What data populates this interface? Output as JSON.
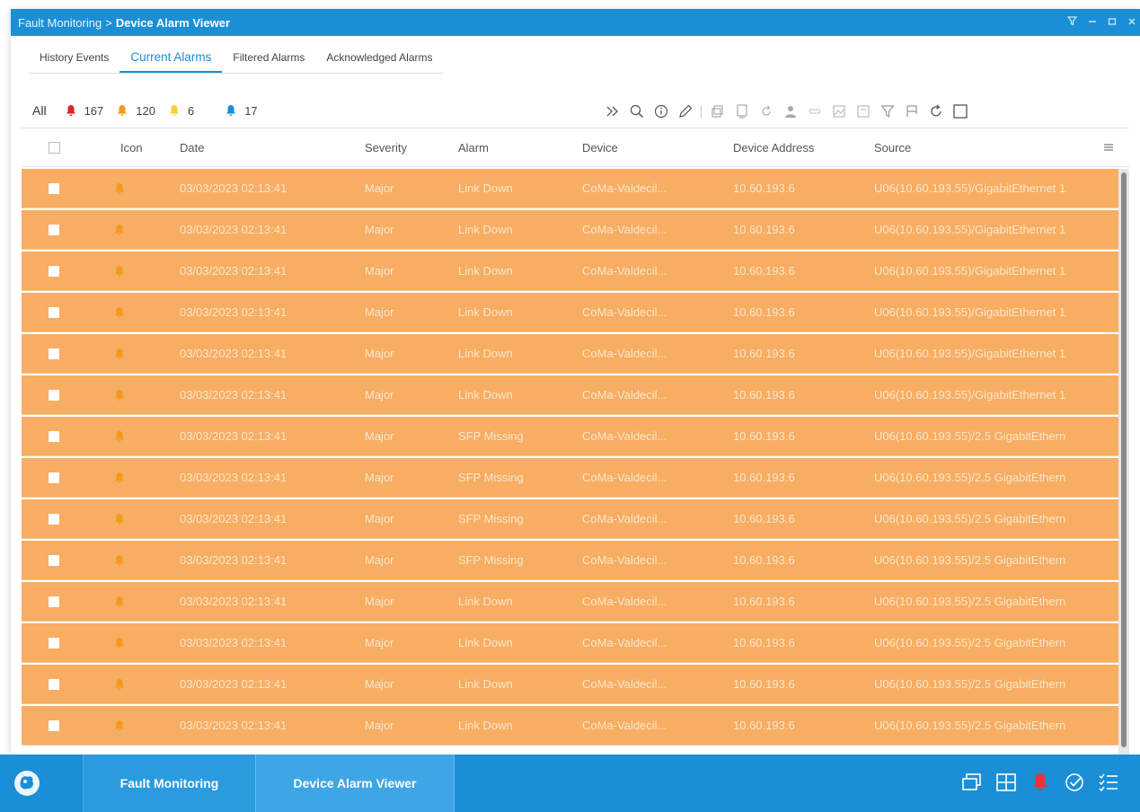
{
  "window": {
    "breadcrumb_parent": "Fault Monitoring",
    "breadcrumb_sep": ">",
    "breadcrumb_current": "Device Alarm Viewer",
    "controls": [
      "filter",
      "minimize",
      "maximize",
      "close"
    ]
  },
  "tabs": [
    {
      "label": "History Events",
      "active": false
    },
    {
      "label": "Current Alarms",
      "active": true
    },
    {
      "label": "Filtered Alarms",
      "active": false
    },
    {
      "label": "Acknowledged Alarms",
      "active": false
    }
  ],
  "summary": {
    "all_label": "All",
    "critical_count": "167",
    "major_count": "120",
    "minor_count": "6",
    "info_count": "17",
    "colors": {
      "critical": "#d9262b",
      "major": "#f39a1b",
      "minor": "#f5d23a",
      "info": "#1a8fd6"
    }
  },
  "toolbar": {
    "icons": [
      "expand-icon",
      "search-icon",
      "info-icon",
      "edit-icon",
      "copy-icon",
      "device-icon",
      "refresh-small-icon",
      "user-icon",
      "link-icon",
      "image-icon",
      "chart-icon",
      "filter-icon",
      "flag-icon",
      "reload-icon",
      "select-all-icon"
    ]
  },
  "grid": {
    "headers": {
      "icon": "Icon",
      "date": "Date",
      "severity": "Severity",
      "alarm": "Alarm",
      "device": "Device",
      "address": "Device Address",
      "source": "Source"
    },
    "rows": [
      {
        "date": "03/03/2023 02:13:41",
        "severity": "Major",
        "alarm": "Link Down",
        "device": "CoMa-Valdecil...",
        "address": "10.60.193.6",
        "source": "U06(10.60.193.55)/GigabitEthernet 1"
      },
      {
        "date": "03/03/2023 02:13:41",
        "severity": "Major",
        "alarm": "Link Down",
        "device": "CoMa-Valdecil...",
        "address": "10.60.193.6",
        "source": "U06(10.60.193.55)/GigabitEthernet 1"
      },
      {
        "date": "03/03/2023 02:13:41",
        "severity": "Major",
        "alarm": "Link Down",
        "device": "CoMa-Valdecil...",
        "address": "10.60.193.6",
        "source": "U06(10.60.193.55)/GigabitEthernet 1"
      },
      {
        "date": "03/03/2023 02:13:41",
        "severity": "Major",
        "alarm": "Link Down",
        "device": "CoMa-Valdecil...",
        "address": "10.60.193.6",
        "source": "U06(10.60.193.55)/GigabitEthernet 1"
      },
      {
        "date": "03/03/2023 02:13:41",
        "severity": "Major",
        "alarm": "Link Down",
        "device": "CoMa-Valdecil...",
        "address": "10.60.193.6",
        "source": "U06(10.60.193.55)/GigabitEthernet 1"
      },
      {
        "date": "03/03/2023 02:13:41",
        "severity": "Major",
        "alarm": "Link Down",
        "device": "CoMa-Valdecil...",
        "address": "10.60.193.6",
        "source": "U06(10.60.193.55)/GigabitEthernet 1"
      },
      {
        "date": "03/03/2023 02:13:41",
        "severity": "Major",
        "alarm": "SFP Missing",
        "device": "CoMa-Valdecil...",
        "address": "10.60.193.6",
        "source": "U06(10.60.193.55)/2.5 GigabitEthern"
      },
      {
        "date": "03/03/2023 02:13:41",
        "severity": "Major",
        "alarm": "SFP Missing",
        "device": "CoMa-Valdecil...",
        "address": "10.60.193.6",
        "source": "U06(10.60.193.55)/2.5 GigabitEthern"
      },
      {
        "date": "03/03/2023 02:13:41",
        "severity": "Major",
        "alarm": "SFP Missing",
        "device": "CoMa-Valdecil...",
        "address": "10.60.193.6",
        "source": "U06(10.60.193.55)/2.5 GigabitEthern"
      },
      {
        "date": "03/03/2023 02:13:41",
        "severity": "Major",
        "alarm": "SFP Missing",
        "device": "CoMa-Valdecil...",
        "address": "10.60.193.6",
        "source": "U06(10.60.193.55)/2.5 GigabitEthern"
      },
      {
        "date": "03/03/2023 02:13:41",
        "severity": "Major",
        "alarm": "Link Down",
        "device": "CoMa-Valdecil...",
        "address": "10.60.193.6",
        "source": "U06(10.60.193.55)/2.5 GigabitEthern"
      },
      {
        "date": "03/03/2023 02:13:41",
        "severity": "Major",
        "alarm": "Link Down",
        "device": "CoMa-Valdecil...",
        "address": "10.60.193.6",
        "source": "U06(10.60.193.55)/2.5 GigabitEthern"
      },
      {
        "date": "03/03/2023 02:13:41",
        "severity": "Major",
        "alarm": "Link Down",
        "device": "CoMa-Valdecil...",
        "address": "10.60.193.6",
        "source": "U06(10.60.193.55)/2.5 GigabitEthern"
      },
      {
        "date": "03/03/2023 02:13:41",
        "severity": "Major",
        "alarm": "Link Down",
        "device": "CoMa-Valdecil...",
        "address": "10.60.193.6",
        "source": "U06(10.60.193.55)/2.5 GigabitEthern"
      }
    ],
    "row_color": "#f7ad62",
    "bell_color": "#f39a1b"
  },
  "taskbar": {
    "tasks": [
      "Fault Monitoring",
      "Device Alarm Viewer"
    ],
    "tray_icons": [
      "windows-icon",
      "grid-icon",
      "alarm-bell-icon",
      "check-circle-icon",
      "task-list-icon"
    ]
  }
}
